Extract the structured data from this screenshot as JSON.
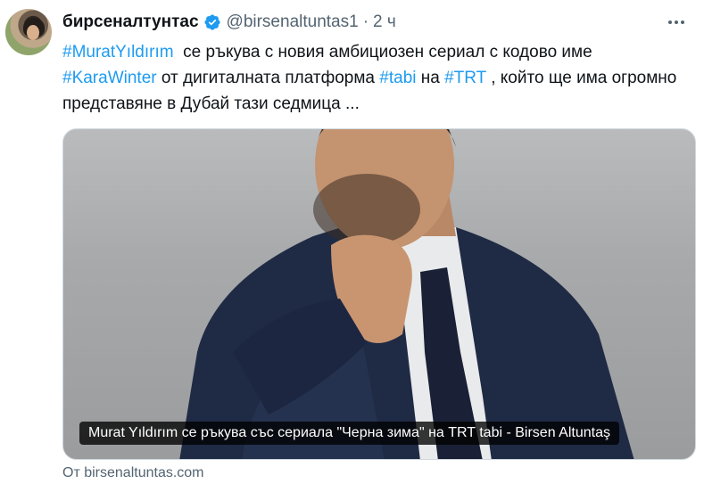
{
  "tweet": {
    "display_name": "бирсеналтунтас",
    "handle": "@birsenaltuntas1",
    "separator": "·",
    "time": "2 ч",
    "text": {
      "tag1": "#MuratYıldırım",
      "part1": "  се ръкува с новия амбициозен сериал с кодово име ",
      "tag2": "#KaraWinter",
      "part2": " от дигиталната платформа ",
      "tag3": "#tabi",
      "part3": " на ",
      "tag4": "#TRT",
      "part4": " , който ще има огромно представяне в Дубай тази седмица ..."
    },
    "card": {
      "caption": "Murat Yıldırım се ръкува със сериала \"Черна зима\" на TRT tabi - Birsen Altuntaş",
      "source": "От birsenaltuntas.com"
    }
  },
  "icons": {
    "verified": "verified-badge-icon",
    "more": "more-options-icon"
  },
  "colors": {
    "link": "#1d9bf0",
    "secondary_text": "#536471",
    "verified": "#1d9bf0"
  }
}
